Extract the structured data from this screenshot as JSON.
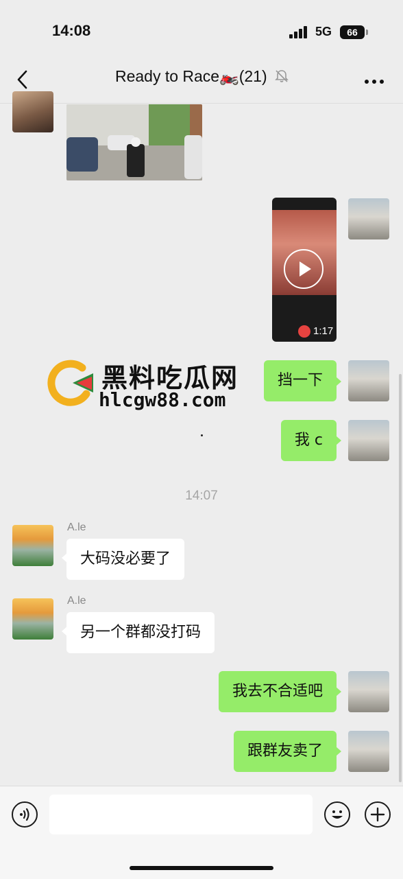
{
  "status_bar": {
    "time": "14:08",
    "network": "5G",
    "battery": "66"
  },
  "header": {
    "title": "Ready to Race🏍️(21)",
    "muted_icon": "bell-slash-icon",
    "more_icon": "ellipsis-icon",
    "back_icon": "chevron-left-icon"
  },
  "messages": {
    "video_duration": "1:17",
    "m1": "挡一下",
    "m2": "我 c",
    "time_separator": "14:07",
    "sender_name": "A.le",
    "m3": "大码没必要了",
    "m4": "另一个群都没打码",
    "m5": "我去不合适吧",
    "m6": "跟群友卖了"
  },
  "watermark": {
    "title": "黑料吃瓜网",
    "url": "hlcgw88.com"
  },
  "input_bar": {
    "voice_icon": "voice-icon",
    "emoji_icon": "emoji-icon",
    "plus_icon": "plus-icon",
    "value": ""
  },
  "colors": {
    "sent_bubble": "#95ec69",
    "received_bubble": "#ffffff",
    "background": "#ededed"
  }
}
